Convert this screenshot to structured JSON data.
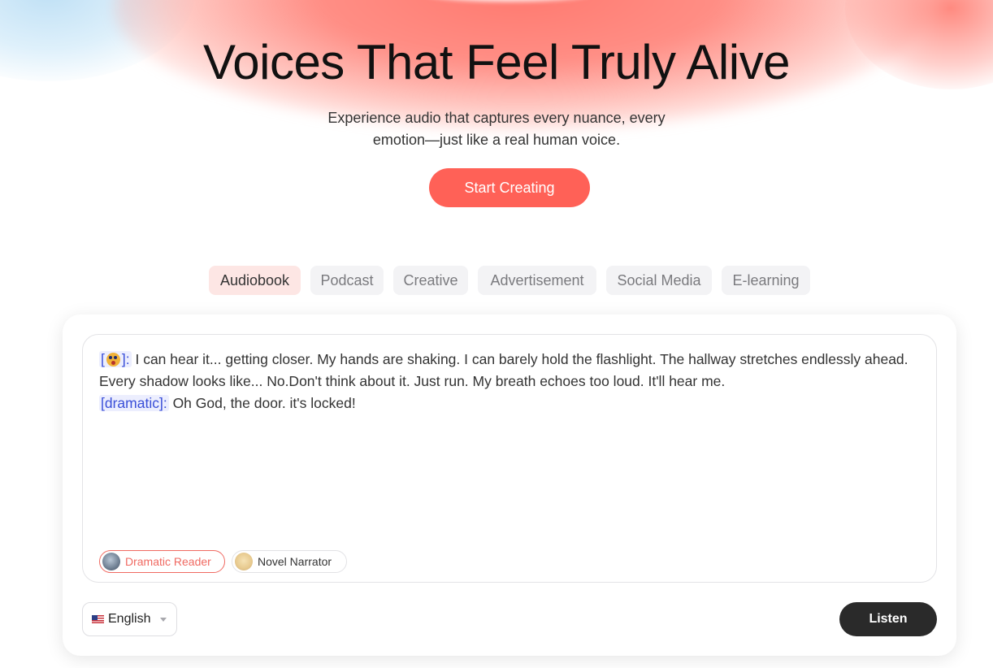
{
  "hero": {
    "title": "Voices That Feel Truly Alive",
    "subtitle_line1": "Experience audio that captures every nuance, every",
    "subtitle_line2": "emotion—just like a real human voice.",
    "cta_label": "Start Creating"
  },
  "tabs": [
    {
      "label": "Audiobook",
      "active": true
    },
    {
      "label": "Podcast",
      "active": false
    },
    {
      "label": "Creative",
      "active": false
    },
    {
      "label": "Advertisement",
      "active": false
    },
    {
      "label": "Social Media",
      "active": false
    },
    {
      "label": "E-learning",
      "active": false
    }
  ],
  "editor": {
    "emotion_tag_open": "[",
    "emotion_tag_icon": "shocked-face-emoji-icon",
    "emotion_tag_close": "]:",
    "paragraph1": " I can hear it... getting closer. My hands are shaking. I can barely hold the flashlight. The hallway stretches endlessly ahead. Every shadow looks like... No.Don't think about it. Just run. My breath echoes too loud. It'll hear me.",
    "dramatic_tag": "[dramatic]:",
    "paragraph2": " Oh God, the door. it's locked!"
  },
  "voices": [
    {
      "label": "Dramatic Reader",
      "selected": true,
      "avatar": "dramatic-reader-avatar"
    },
    {
      "label": "Novel Narrator",
      "selected": false,
      "avatar": "novel-narrator-avatar"
    }
  ],
  "language": {
    "label": "English",
    "flag": "us-flag-icon"
  },
  "listen_label": "Listen",
  "colors": {
    "accent": "#ff6157",
    "tag_text": "#3a4fd8",
    "tag_bg": "#eceefe",
    "active_tab_bg": "#fde6e4",
    "listen_bg": "#2a2a2a"
  }
}
